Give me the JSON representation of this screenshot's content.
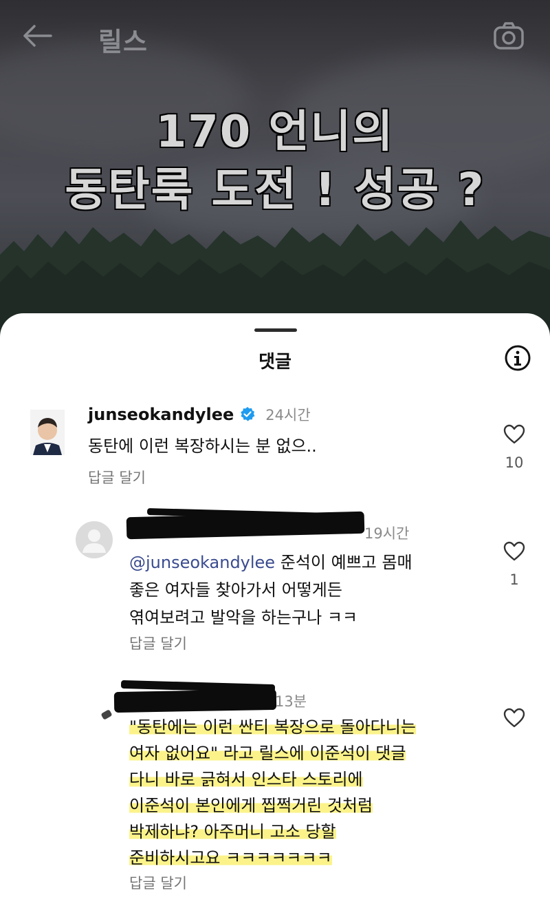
{
  "header": {
    "back_icon": "arrow-left-icon",
    "title": "릴스",
    "camera_icon": "camera-icon"
  },
  "reel_caption": {
    "line1": "170 언니의",
    "line2": "동탄룩 도전 ! 성공 ?"
  },
  "comments_sheet": {
    "title": "댓글",
    "info_icon": "info-icon",
    "comments": [
      {
        "username": "junseokandylee",
        "verified": true,
        "time": "24시간",
        "text": "동탄에 이런 복장하시는 분 없으..",
        "reply_label": "답글 달기",
        "likes": "10"
      },
      {
        "username_redacted": true,
        "time": "19시간",
        "mention": "@junseokandylee",
        "text_lines": [
          "준석이 예쁘고 몸매",
          "좋은 여자들 찾아가서 어떻게든",
          "엮여보려고 발악을 하는구나 ㅋㅋ"
        ],
        "reply_label": "답글 달기",
        "likes": "1"
      },
      {
        "username_redacted": true,
        "time": "13분",
        "text_lines": [
          "\"동탄에는 이런 싼티 복장으로 돌아다니는",
          "여자 없어요\" 라고 릴스에 이준석이 댓글",
          "다니 바로 긁혀서 인스타 스토리에",
          "이준석이 본인에게 찝쩍거린 것처럼",
          "박제하냐? 아주머니 고소 당할",
          "준비하시고요 ㅋㅋㅋㅋㅋㅋㅋ"
        ],
        "reply_label": "답글 달기",
        "likes": ""
      }
    ]
  },
  "colors": {
    "highlight": "#fbf38a",
    "verified": "#1d9bf0",
    "mention": "#3a4b8f"
  }
}
